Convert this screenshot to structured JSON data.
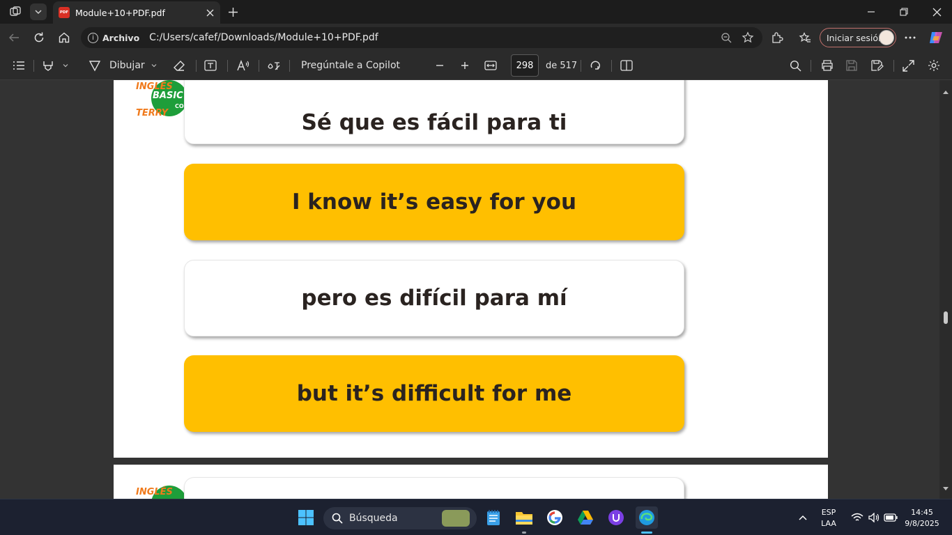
{
  "tab": {
    "title": "Module+10+PDF.pdf",
    "badge": "PDF"
  },
  "address": {
    "label": "Archivo",
    "url": "C:/Users/cafef/Downloads/Module+10+PDF.pdf"
  },
  "profile": {
    "signin": "Iniciar sesión"
  },
  "pdf_toolbar": {
    "draw_label": "Dibujar",
    "copilot_label": "Pregúntale a Copilot",
    "current_page": "298",
    "total_pages": "de 517"
  },
  "page_content": {
    "logo": {
      "line1": "INGLÉS",
      "line2": "BASIC",
      "line3": "TERRY",
      "line4": "CO"
    },
    "cards": [
      {
        "text": "Sé que es fácil para ti",
        "style": "white"
      },
      {
        "text": "I know it’s easy for you",
        "style": "yellow"
      },
      {
        "text": "pero es difícil para mí",
        "style": "white"
      },
      {
        "text": "but it’s difficult for me",
        "style": "yellow"
      }
    ],
    "next_logo": {
      "line1": "INGLÉS"
    }
  },
  "taskbar": {
    "search_placeholder": "Búsqueda",
    "lang_top": "ESP",
    "lang_bottom": "LAA",
    "time": "14:45",
    "date": "9/8/2025"
  },
  "colors": {
    "accent_yellow": "#ffbf00",
    "logo_green": "#1e9e3a",
    "logo_orange": "#f07a1c"
  }
}
